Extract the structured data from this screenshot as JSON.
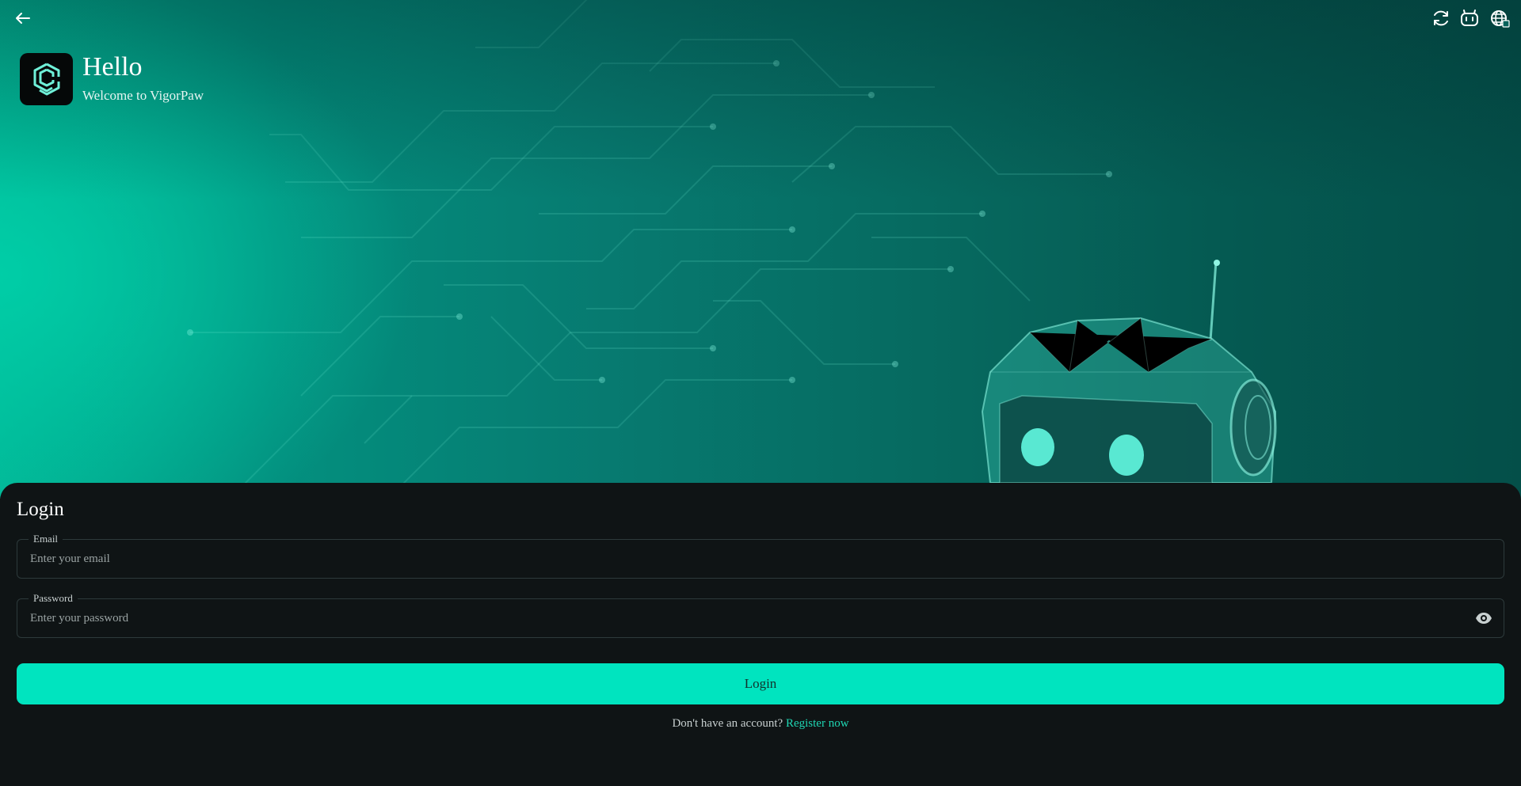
{
  "colors": {
    "accent": "#00e4bf",
    "panel_bg": "#0f1415",
    "link": "#1fd6b3",
    "hero_teal": "#02b394"
  },
  "topbar": {
    "back_icon": "arrow-left-icon",
    "right_icons": [
      "refresh-icon",
      "game-controller-icon",
      "globe-icon"
    ]
  },
  "header": {
    "logo_icon": "app-logo-icon",
    "title": "Hello",
    "subtitle": "Welcome to VigorPaw"
  },
  "login": {
    "title": "Login",
    "email": {
      "label": "Email",
      "placeholder": "Enter your email",
      "value": ""
    },
    "password": {
      "label": "Password",
      "placeholder": "Enter your password",
      "value": "",
      "toggle_icon": "eye-icon"
    },
    "submit_label": "Login",
    "register_prompt": "Don't have an account?",
    "register_link": "Register now"
  }
}
